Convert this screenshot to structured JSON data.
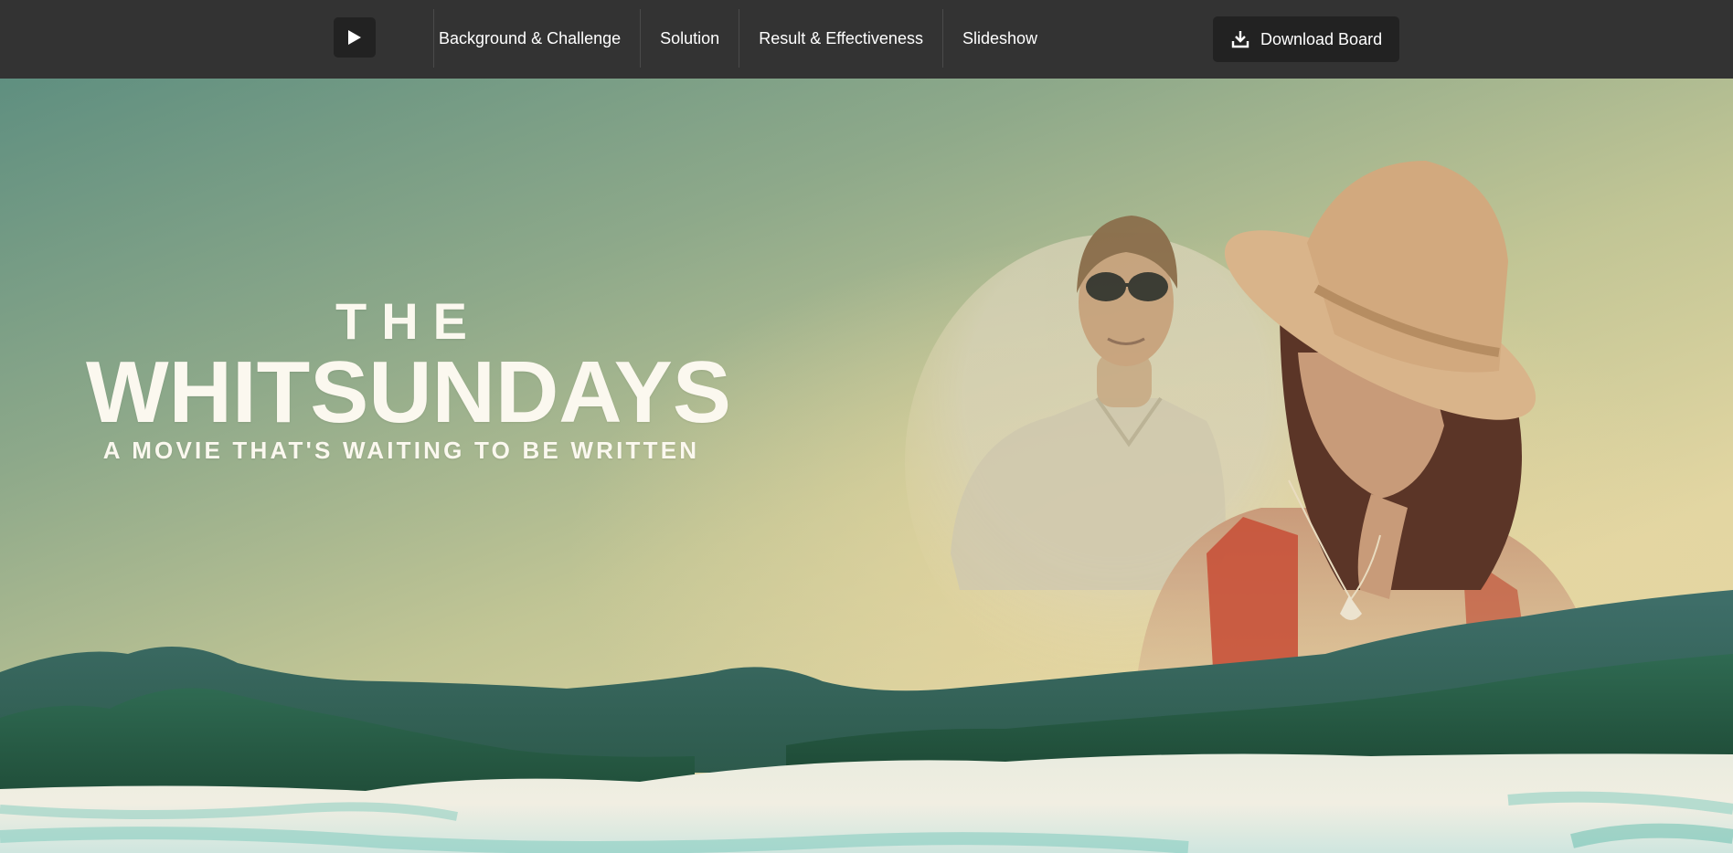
{
  "toolbar": {
    "play_icon": "play-icon",
    "nav": [
      {
        "label": "Background & Challenge"
      },
      {
        "label": "Solution"
      },
      {
        "label": "Result & Effectiveness"
      },
      {
        "label": "Slideshow"
      }
    ],
    "download_label": "Download Board",
    "download_icon": "download-icon"
  },
  "hero": {
    "title_small": "THE",
    "title_main": "WHITSUNDAYS",
    "tagline": "A MOVIE THAT'S WAITING TO BE WRITTEN"
  },
  "colors": {
    "toolbar_bg": "#333333",
    "button_bg": "#222222",
    "title_text": "#fbf8ef"
  }
}
